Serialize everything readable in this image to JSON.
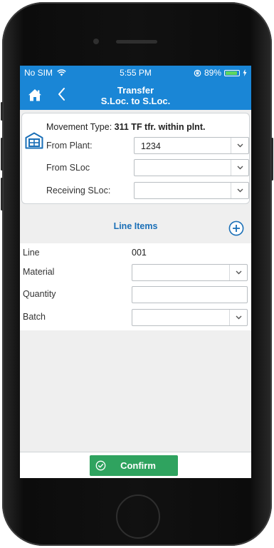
{
  "status_bar": {
    "carrier": "No SIM",
    "time": "5:55 PM",
    "battery": "89%",
    "battery_level": 0.89
  },
  "nav": {
    "title_line1": "Transfer",
    "title_line2": "S.Loc. to S.Loc."
  },
  "header": {
    "movement_type_label": "Movement Type:",
    "movement_type_value": "311 TF tfr. within plnt.",
    "from_plant_label": "From Plant:",
    "from_plant_value": "1234",
    "from_sloc_label": "From SLoc",
    "from_sloc_value": "",
    "receiving_sloc_label": "Receiving SLoc:",
    "receiving_sloc_value": ""
  },
  "line_items": {
    "title": "Line Items",
    "line_label": "Line",
    "line_value": "001",
    "material_label": "Material",
    "material_value": "",
    "quantity_label": "Quantity",
    "quantity_value": "",
    "batch_label": "Batch",
    "batch_value": ""
  },
  "footer": {
    "confirm_label": "Confirm"
  },
  "colors": {
    "accent": "#1a86d6",
    "confirm": "#2fa35f",
    "title_blue": "#1a6fb7"
  }
}
